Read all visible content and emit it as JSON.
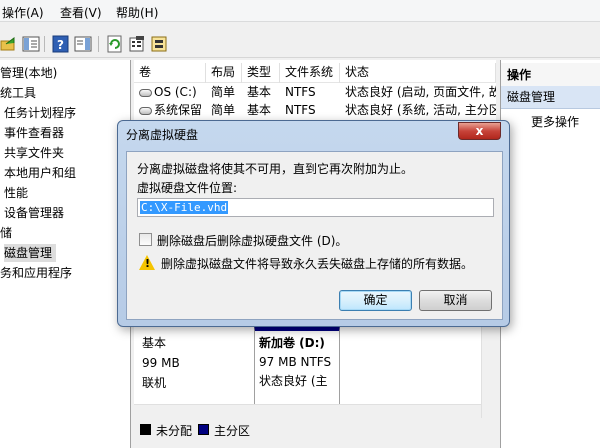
{
  "menu": {
    "action": "操作(A)",
    "view": "查看(V)",
    "help": "帮助(H)"
  },
  "tree": {
    "items": [
      "管理(本地)",
      "统工具",
      "任务计划程序",
      "事件查看器",
      "共享文件夹",
      "本地用户和组",
      "性能",
      "设备管理器",
      "储",
      "磁盘管理",
      "务和应用程序"
    ]
  },
  "volumes": {
    "headers": [
      "卷",
      "布局",
      "类型",
      "文件系统",
      "状态"
    ],
    "rows": [
      [
        "OS (C:)",
        "简单",
        "基本",
        "NTFS",
        "状态良好 (启动, 页面文件, 故"
      ],
      [
        "系统保留",
        "简单",
        "基本",
        "NTFS",
        "状态良好 (系统, 活动, 主分区"
      ]
    ]
  },
  "disk": {
    "type": "基本",
    "size": "99 MB",
    "status": "联机",
    "partition": {
      "name": "新加卷 (D:)",
      "size": "97 MB NTFS",
      "status": "状态良好 (主"
    }
  },
  "legend": {
    "unallocated": "未分配",
    "primary": "主分区"
  },
  "actions": {
    "header": "操作",
    "selected": "磁盘管理",
    "more": "更多操作"
  },
  "dialog": {
    "title": "分离虚拟硬盘",
    "description": "分离虚拟磁盘将使其不可用，直到它再次附加为止。",
    "path_label": "虚拟硬盘文件位置:",
    "path_value": "C:\\X-File.vhd",
    "checkbox_label": "删除磁盘后删除虚拟硬盘文件 (D)。",
    "warning": "删除虚拟磁盘文件将导致永久丢失磁盘上存储的所有数据。",
    "ok": "确定",
    "cancel": "取消",
    "close": "x"
  },
  "colors": {
    "primary_partition": "#000080",
    "unallocated": "#000000",
    "selection": "#3399ff"
  }
}
